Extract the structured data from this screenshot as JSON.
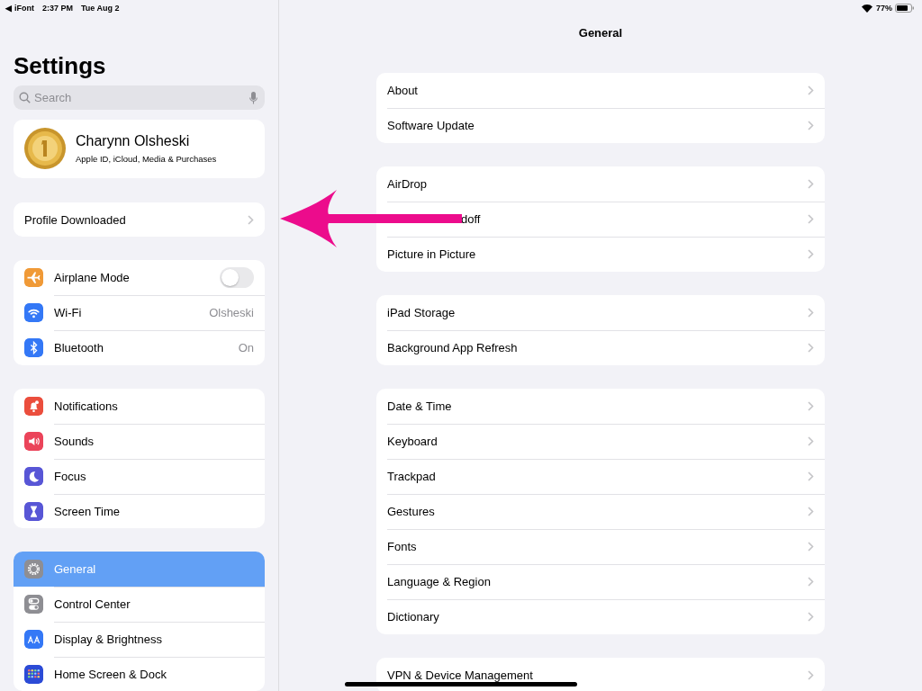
{
  "status_bar": {
    "back_glyph": "◀",
    "back_label": "iFont",
    "time": "2:37 PM",
    "date": "Tue Aug 2",
    "battery": "77%"
  },
  "sidebar": {
    "title": "Settings",
    "search": {
      "placeholder": "Search"
    },
    "profile": {
      "name": "Charynn Olsheski",
      "subtitle": "Apple ID, iCloud, Media & Purchases"
    },
    "notice": {
      "label": "Profile Downloaded",
      "selected": false
    },
    "groups": [
      [
        {
          "label": "Airplane Mode",
          "color": "#f09a37",
          "kind": "toggle",
          "on": false,
          "selected": false
        },
        {
          "label": "Wi-Fi",
          "color": "#3478f6",
          "kind": "value",
          "value": "Olsheski",
          "selected": false
        },
        {
          "label": "Bluetooth",
          "color": "#3478f6",
          "kind": "value",
          "value": "On",
          "selected": false
        }
      ],
      [
        {
          "label": "Notifications",
          "color": "#eb4e3d",
          "kind": "plain",
          "selected": false
        },
        {
          "label": "Sounds",
          "color": "#eb445a",
          "kind": "plain",
          "selected": false
        },
        {
          "label": "Focus",
          "color": "#5856d6",
          "kind": "plain",
          "selected": false
        },
        {
          "label": "Screen Time",
          "color": "#5856d6",
          "kind": "plain",
          "selected": false
        }
      ],
      [
        {
          "label": "General",
          "color": "#8e8e93",
          "kind": "plain",
          "selected": true
        },
        {
          "label": "Control Center",
          "color": "#8e8e93",
          "kind": "plain",
          "selected": false
        },
        {
          "label": "Display & Brightness",
          "color": "#3478f6",
          "kind": "plain",
          "selected": false
        },
        {
          "label": "Home Screen & Dock",
          "color": "#2c4bd6",
          "kind": "plain",
          "selected": false
        }
      ]
    ]
  },
  "detail": {
    "title": "General",
    "groups": [
      [
        {
          "label": "About",
          "covered": false
        },
        {
          "label": "Software Update",
          "covered": false
        }
      ],
      [
        {
          "label": "AirDrop",
          "covered": false
        },
        {
          "label": "doff",
          "covered": true
        },
        {
          "label": "Picture in Picture",
          "covered": false
        }
      ],
      [
        {
          "label": "iPad Storage",
          "covered": false
        },
        {
          "label": "Background App Refresh",
          "covered": false
        }
      ],
      [
        {
          "label": "Date & Time",
          "covered": false
        },
        {
          "label": "Keyboard",
          "covered": false
        },
        {
          "label": "Trackpad",
          "covered": false
        },
        {
          "label": "Gestures",
          "covered": false
        },
        {
          "label": "Fonts",
          "covered": false
        },
        {
          "label": "Language & Region",
          "covered": false
        },
        {
          "label": "Dictionary",
          "covered": false
        }
      ],
      [
        {
          "label": "VPN & Device Management",
          "covered": false
        }
      ]
    ]
  },
  "annotation": {
    "kind": "arrow"
  }
}
